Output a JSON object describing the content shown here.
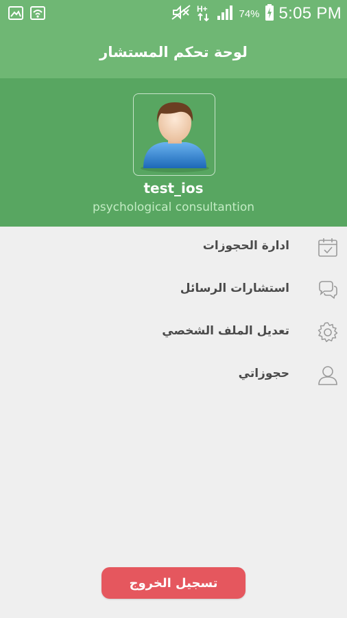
{
  "status_bar": {
    "battery_percent": "74%",
    "time": "5:05 PM",
    "network_type": "H+",
    "icons": [
      "gallery-icon",
      "wifi-icon",
      "mute-icon",
      "network-h-plus-icon",
      "signal-icon",
      "battery-charging-icon"
    ]
  },
  "app_bar": {
    "title": "لوحة تحكم المستشار"
  },
  "profile": {
    "username": "test_ios",
    "specialty": "psychological consultantion",
    "avatar_icon": "user-avatar-icon"
  },
  "menu": {
    "items": [
      {
        "label": "ادارة الحجوزات",
        "icon": "calendar-check-icon"
      },
      {
        "label": "استشارات الرسائل",
        "icon": "chat-bubbles-icon"
      },
      {
        "label": "تعديل الملف الشخصي",
        "icon": "gear-icon"
      },
      {
        "label": "حجوزاتي",
        "icon": "person-icon"
      }
    ]
  },
  "logout": {
    "label": "تسجيل الخروج"
  },
  "colors": {
    "app_bar": "#6fb774",
    "profile_bg": "#58a661",
    "background": "#efefef",
    "logout_button": "#e5575e",
    "specialty_text": "#c3ecc4",
    "menu_text": "#4a4a4a",
    "icon_gray": "#9a9a9a"
  }
}
